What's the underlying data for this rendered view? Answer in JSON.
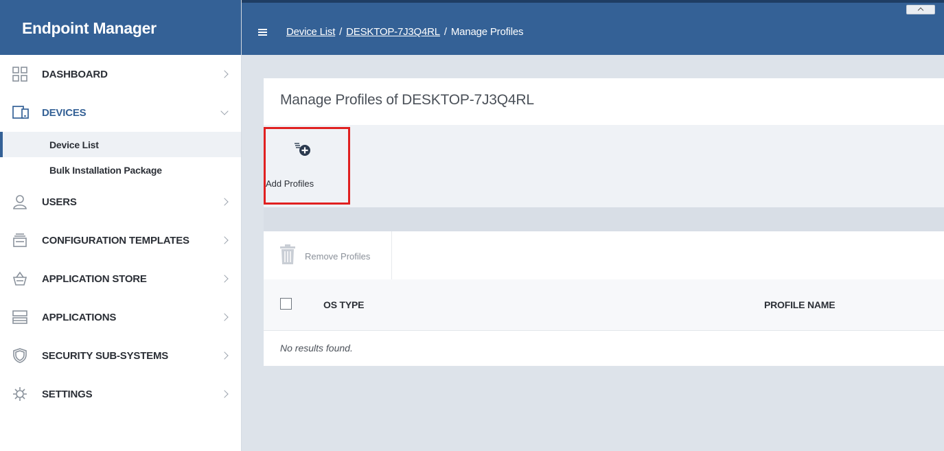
{
  "brand": {
    "title": "Endpoint Manager"
  },
  "sidebar": {
    "items": [
      {
        "label": "DASHBOARD",
        "icon": "dashboard-icon"
      },
      {
        "label": "DEVICES",
        "icon": "devices-icon",
        "expanded": true,
        "children": [
          {
            "label": "Device List",
            "active": true
          },
          {
            "label": "Bulk Installation Package"
          }
        ]
      },
      {
        "label": "USERS",
        "icon": "user-icon"
      },
      {
        "label": "CONFIGURATION TEMPLATES",
        "icon": "templates-icon"
      },
      {
        "label": "APPLICATION STORE",
        "icon": "basket-icon"
      },
      {
        "label": "APPLICATIONS",
        "icon": "applications-icon"
      },
      {
        "label": "SECURITY SUB-SYSTEMS",
        "icon": "shield-icon"
      },
      {
        "label": "SETTINGS",
        "icon": "gear-icon"
      }
    ]
  },
  "header": {
    "breadcrumb": [
      {
        "label": "Device List",
        "link": true
      },
      {
        "label": "DESKTOP-7J3Q4RL",
        "link": true
      },
      {
        "label": "Manage Profiles",
        "link": false
      }
    ],
    "separator": "/"
  },
  "main": {
    "title": "Manage Profiles of DESKTOP-7J3Q4RL",
    "toolbar": {
      "add_label": "Add Profiles"
    },
    "table": {
      "remove_label": "Remove Profiles",
      "columns": [
        "OS TYPE",
        "PROFILE NAME"
      ],
      "empty_text": "No results found."
    }
  },
  "colors": {
    "brand": "#346196",
    "highlight": "#e02020"
  }
}
